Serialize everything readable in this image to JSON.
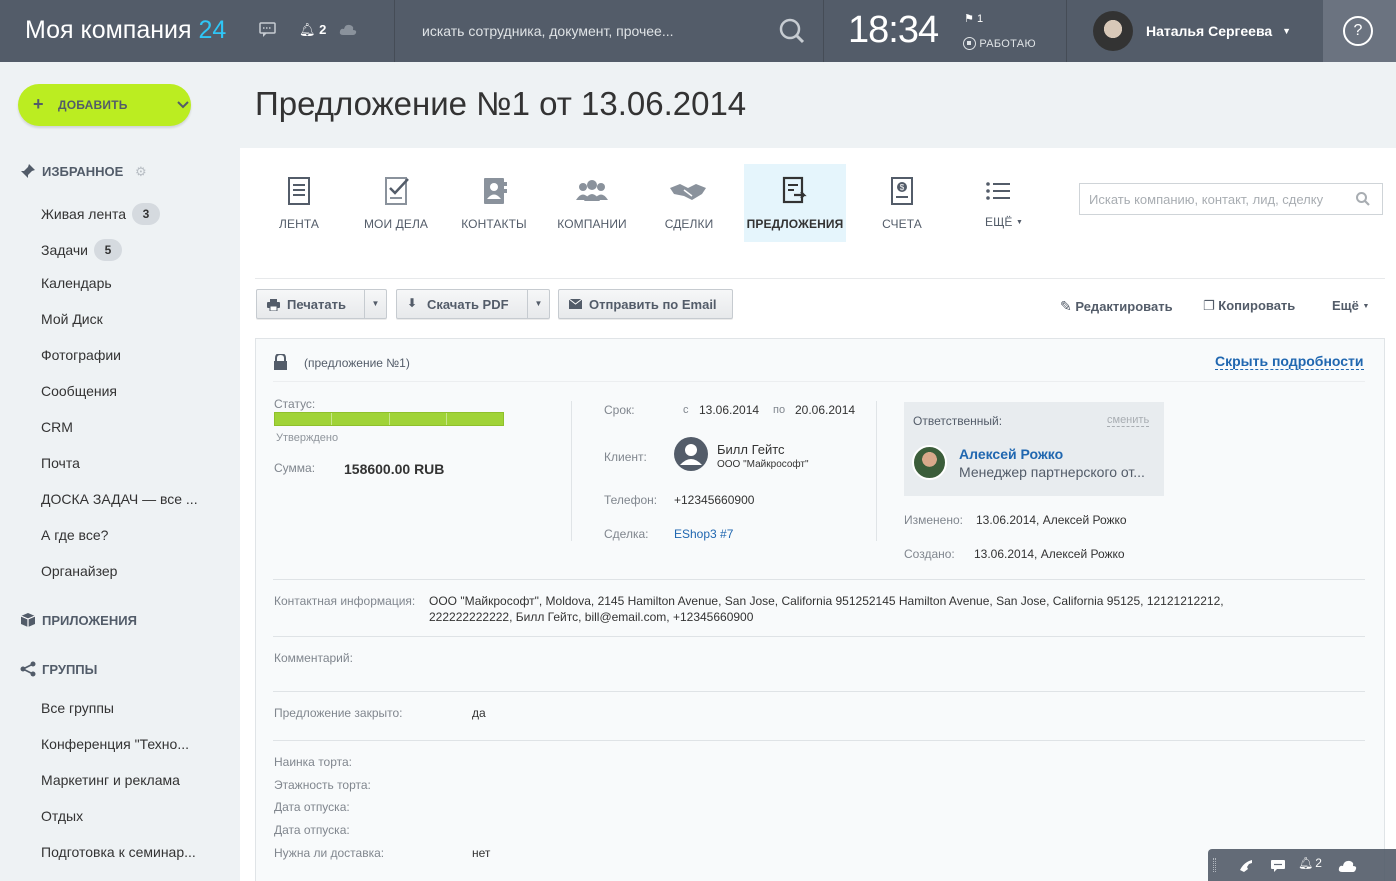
{
  "header": {
    "logo_main": "Моя компания",
    "logo_num": "24",
    "notifications_count": "2",
    "search_placeholder": "искать сотрудника, документ, прочее...",
    "clock": "18:34",
    "flag_count": "1",
    "work_status": "РАБОТАЮ",
    "user_name": "Наталья Сергеева",
    "help": "?"
  },
  "sidebar": {
    "add_label": "ДОБАВИТЬ",
    "favorites_title": "ИЗБРАННОЕ",
    "items": [
      {
        "label": "Живая лента",
        "count": "3"
      },
      {
        "label": "Задачи",
        "count": "5"
      },
      {
        "label": "Календарь"
      },
      {
        "label": "Мой Диск"
      },
      {
        "label": "Фотографии"
      },
      {
        "label": "Сообщения"
      },
      {
        "label": "CRM"
      },
      {
        "label": "Почта"
      },
      {
        "label": "ДОСКА ЗАДАЧ — все ..."
      },
      {
        "label": "А где все?"
      },
      {
        "label": "Органайзер"
      }
    ],
    "apps_title": "ПРИЛОЖЕНИЯ",
    "groups_title": "ГРУППЫ",
    "groups": [
      {
        "label": "Все группы"
      },
      {
        "label": "Конференция \"Техно..."
      },
      {
        "label": "Маркетинг и реклама"
      },
      {
        "label": "Отдых"
      },
      {
        "label": "Подготовка к семинар..."
      }
    ]
  },
  "page": {
    "title": "Предложение №1 от 13.06.2014"
  },
  "tabs": [
    {
      "label": "ЛЕНТА"
    },
    {
      "label": "МОИ ДЕЛА"
    },
    {
      "label": "КОНТАКТЫ"
    },
    {
      "label": "КОМПАНИИ"
    },
    {
      "label": "СДЕЛКИ"
    },
    {
      "label": "ПРЕДЛОЖЕНИЯ"
    },
    {
      "label": "СЧЕТА"
    },
    {
      "label": "ЕЩЁ"
    }
  ],
  "crm_search_placeholder": "Искать компанию, контакт, лид, сделку",
  "toolbar": {
    "print": "Печатать",
    "pdf": "Скачать PDF",
    "email": "Отправить по Email",
    "edit": "Редактировать",
    "copy": "Копировать",
    "more": "Ещё"
  },
  "card": {
    "subtitle": "(предложение №1)",
    "hide_details": "Скрыть подробности",
    "status_label": "Статус:",
    "status_value": "Утверждено",
    "status_progress": 1.0,
    "sum_label": "Сумма:",
    "sum_value": "158600.00 RUB",
    "term_label": "Срок:",
    "term_from_prefix": "с",
    "term_from": "13.06.2014",
    "term_to_prefix": "по",
    "term_to": "20.06.2014",
    "client_label": "Клиент:",
    "client_name": "Билл Гейтс",
    "client_company": "ООО \"Майкрософт\"",
    "phone_label": "Телефон:",
    "phone_value": "+12345660900",
    "deal_label": "Сделка:",
    "deal_value": "EShop3 #7",
    "resp_label": "Ответственный:",
    "resp_change": "сменить",
    "resp_name": "Алексей Рожко",
    "resp_position": "Менеджер партнерского от...",
    "changed_label": "Изменено:",
    "changed_value": "13.06.2014, Алексей Рожко",
    "created_label": "Создано:",
    "created_value": "13.06.2014, Алексей Рожко",
    "contact_info_label": "Контактная информация:",
    "contact_info_line1": "ООО \"Майкрософт\", Moldova, 2145 Hamilton Avenue, San Jose, California 951252145 Hamilton Avenue, San Jose, California 95125, 12121212212,",
    "contact_info_line2": "222222222222, Билл Гейтс, bill@email.com, +12345660900",
    "comment_label": "Комментарий:",
    "closed_label": "Предложение закрыто:",
    "closed_value": "да",
    "custom_fields": [
      {
        "label": "Наинка торта:",
        "value": ""
      },
      {
        "label": "Этажность торта:",
        "value": ""
      },
      {
        "label": "Дата отпуска:",
        "value": ""
      },
      {
        "label": "Дата отпуска:",
        "value": ""
      },
      {
        "label": "Нужна ли доставка:",
        "value": "нет"
      }
    ]
  },
  "bottom_bar": {
    "notifications": "2"
  },
  "colors": {
    "header_bg": "#535c69",
    "accent": "#2fc6f6",
    "add_button": "#bbed21",
    "status_bar": "#a0d337",
    "link": "#2067b0"
  }
}
